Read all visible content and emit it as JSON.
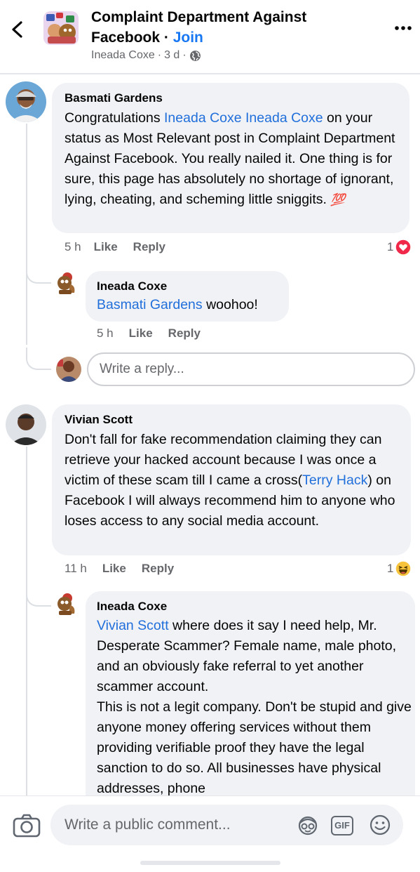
{
  "header": {
    "group_name": "Complaint Department Against Facebook",
    "separator": " · ",
    "join_label": "Join",
    "author": "Ineada Coxe",
    "age": "3 d",
    "meta_sep": "·",
    "privacy_icon": "globe-icon",
    "back_icon": "chevron-left-icon",
    "more_icon": "more-dots-icon"
  },
  "comments": [
    {
      "author": "Basmati Gardens",
      "mention": "Ineada Coxe Ineada Coxe",
      "text_before": "Congratulations ",
      "text_after": " on your status as Most Relevant post in Complaint Department Against Facebook. You really nailed it. One thing is for sure, this page has absolutely no shortage of ignorant, lying, cheating, and scheming little sniggits. ",
      "emoji": "💯",
      "time": "5 h",
      "like_label": "Like",
      "reply_label": "Reply",
      "reaction_count": "1",
      "reaction_icon": "love-reaction-icon"
    },
    {
      "author": "Ineada Coxe",
      "mention": "Basmati Gardens",
      "text_after": " woohoo!",
      "time": "5 h",
      "like_label": "Like",
      "reply_label": "Reply"
    },
    {
      "author": "Vivian Scott",
      "text_before": "Don't fall for fake recommendation claiming they can retrieve your hacked account because I was once a victim of these scam till I came a cross(",
      "mention": "Terry Hack",
      "text_after": ") on Facebook I will always recommend him to anyone who loses access to any social media account.",
      "time": "11 h",
      "like_label": "Like",
      "reply_label": "Reply",
      "reaction_count": "1",
      "reaction_icon": "haha-reaction-icon"
    },
    {
      "author": "Ineada Coxe",
      "mention": "Vivian Scott",
      "text_after": " where does it say I need help, Mr. Desperate Scammer? Female name, male photo, and an obviously fake referral to yet another scammer account.",
      "text_second": "This is not a legit company. Don't be stupid and give anyone money offering services without them providing verifiable proof they have the legal sanction to do so. All businesses have physical addresses, phone"
    }
  ],
  "reply_input": {
    "placeholder": "Write a reply..."
  },
  "composer": {
    "placeholder": "Write a public comment...",
    "camera_icon": "camera-icon",
    "avatar_sticker_icon": "avatar-sticker-icon",
    "gif_label": "GIF",
    "emoji_icon": "smiley-icon"
  }
}
